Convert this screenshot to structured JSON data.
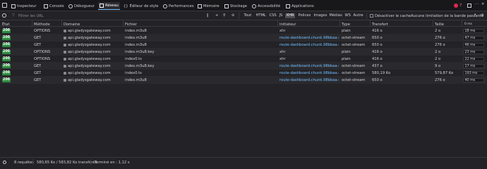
{
  "toolbar": {
    "tabs": [
      {
        "label": "Inspecteur"
      },
      {
        "label": "Console"
      },
      {
        "label": "Débogueur"
      },
      {
        "label": "Réseau"
      },
      {
        "label": "Éditeur de style"
      },
      {
        "label": "Performances"
      },
      {
        "label": "Mémoire"
      },
      {
        "label": "Stockage"
      },
      {
        "label": "Accessibilité"
      },
      {
        "label": "Applications"
      }
    ],
    "error_count": "7"
  },
  "filterbar": {
    "placeholder": "Filtrer les URL",
    "types": [
      "Tout",
      "HTML",
      "CSS",
      "JS",
      "XHR",
      "Polices",
      "Images",
      "Médias",
      "WS",
      "Autre"
    ],
    "selected_type": "XHR",
    "disable_cache": "Désactiver le cache",
    "throttling": "Aucune limitation de la bande passante"
  },
  "columns": {
    "etat": "État",
    "methode": "Méthode",
    "domaine": "Domaine",
    "fichier": "Fichier",
    "initiateur": "Initiateur",
    "type": "Type",
    "transfert": "Transfert",
    "taille": "Taille",
    "timeline": "0 ms"
  },
  "rows": [
    {
      "status": "200",
      "method": "OPTIONS",
      "domain": "api.gladysgateway.com",
      "file": "index.m3u8",
      "initiator": "xhr",
      "initiator_link": false,
      "type": "plain",
      "transfer": "416 o",
      "size": "2 o",
      "time": "18 ms"
    },
    {
      "status": "200",
      "method": "GET",
      "domain": "api.gladysgateway.com",
      "file": "index.m3u8",
      "initiator": "route-dashboard.chunk.98bbaa.esm.j...",
      "initiator_link": true,
      "type": "octet-stream",
      "transfer": "650 o",
      "size": "276 o",
      "time": "47 ms"
    },
    {
      "status": "200",
      "method": "GET",
      "domain": "api.gladysgateway.com",
      "file": "index.m3u8",
      "initiator": "route-dashboard.chunk.98bbaa.esm.j...",
      "initiator_link": true,
      "type": "octet-stream",
      "transfer": "650 o",
      "size": "276 o",
      "time": "46 ms"
    },
    {
      "status": "200",
      "method": "OPTIONS",
      "domain": "api.gladysgateway.com",
      "file": "index.m3u8.key",
      "initiator": "xhr",
      "initiator_link": false,
      "type": "plain",
      "transfer": "416 o",
      "size": "2 o",
      "time": "23 ms"
    },
    {
      "status": "200",
      "method": "OPTIONS",
      "domain": "api.gladysgateway.com",
      "file": "index0.ts",
      "initiator": "xhr",
      "initiator_link": false,
      "type": "plain",
      "transfer": "416 o",
      "size": "2 o",
      "time": "22 ms"
    },
    {
      "status": "200",
      "method": "GET",
      "domain": "api.gladysgateway.com",
      "file": "index.m3u8.key",
      "initiator": "route-dashboard.chunk.98bbaa.esm.j...",
      "initiator_link": true,
      "type": "octet-stream",
      "transfer": "437 o",
      "size": "9 o",
      "time": "17 ms"
    },
    {
      "status": "200",
      "method": "GET",
      "domain": "api.gladysgateway.com",
      "file": "index0.ts",
      "initiator": "route-dashboard.chunk.98bbaa.esm.j...",
      "initiator_link": true,
      "type": "octet-stream",
      "transfer": "580,19 Ko",
      "size": "579,87 Ko",
      "time": "193 ms"
    },
    {
      "status": "200",
      "method": "GET",
      "domain": "api.gladysgateway.com",
      "file": "index.m3u8",
      "initiator": "route-dashboard.chunk.98bbaa.esm.j...",
      "initiator_link": true,
      "type": "octet-stream",
      "transfer": "650 o",
      "size": "276 o",
      "time": "40 ms"
    }
  ],
  "statusbar": {
    "requests": "8 requêtes",
    "transferred": "580,65 Ko / 583,82 Ko transférés",
    "finished": "Terminé en : 1,12 s"
  },
  "colors": {
    "accent": "#75bfff",
    "status_ok": "#2b8a3e",
    "background": "#232327"
  }
}
